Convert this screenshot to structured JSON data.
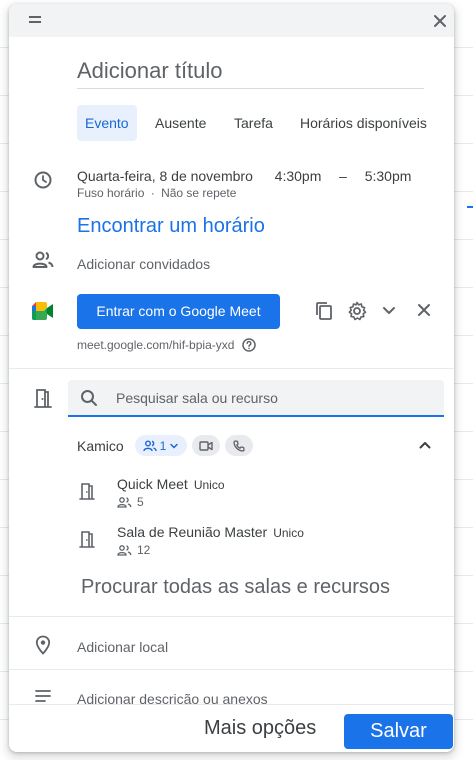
{
  "title": {
    "placeholder": "Adicionar título"
  },
  "tabs": [
    {
      "label": "Evento",
      "active": true
    },
    {
      "label": "Ausente"
    },
    {
      "label": "Tarefa"
    },
    {
      "label": "Horários disponíveis"
    }
  ],
  "datetime": {
    "date": "Quarta-feira, 8 de novembro",
    "start": "4:30pm",
    "dash": "–",
    "end": "5:30pm",
    "timezone": "Fuso horário",
    "separator": "·",
    "repeat": "Não se repete"
  },
  "find_time": "Encontrar um horário",
  "guests": {
    "label": "Adicionar convidados"
  },
  "meet": {
    "button": "Entrar com o Google Meet",
    "link": "meet.google.com/hif-bpia-yxd"
  },
  "rooms": {
    "search_placeholder": "Pesquisar sala ou recurso",
    "building": "Kamico",
    "capacity_filter": "1",
    "items": [
      {
        "name": "Quick Meet",
        "tag": "Unico",
        "capacity": "5"
      },
      {
        "name": "Sala de Reunião Master",
        "tag": "Unico",
        "capacity": "12"
      }
    ],
    "browse_all": "Procurar todas as salas e recursos"
  },
  "location": {
    "label": "Adicionar local"
  },
  "description": {
    "label": "Adicionar descrição ou anexos"
  },
  "footer": {
    "more": "Mais opções",
    "save": "Salvar"
  },
  "colors": {
    "accent": "#1a73e8",
    "chip_blue_bg": "#e8f0fe"
  }
}
